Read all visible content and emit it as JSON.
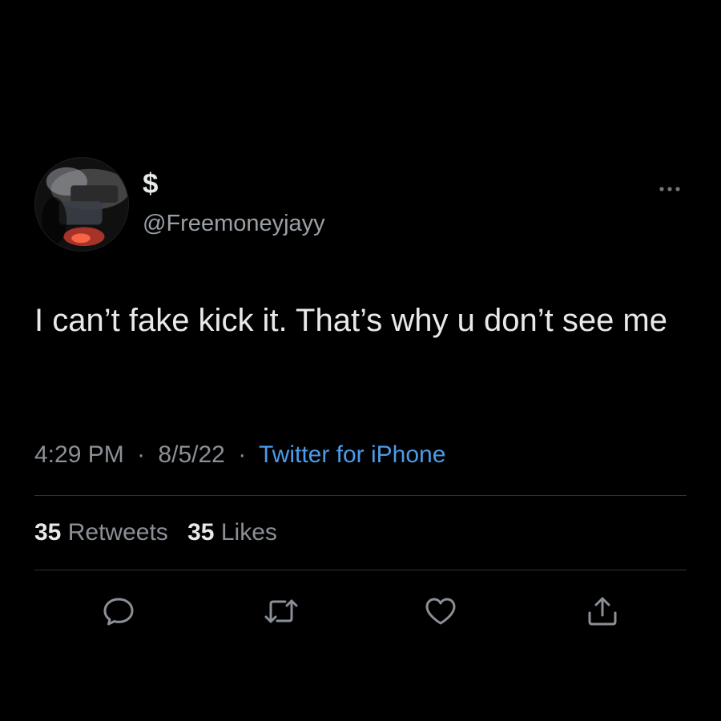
{
  "user": {
    "display_name": "$",
    "handle": "@Freemoneyjayy"
  },
  "tweet": {
    "text": "I can’t fake kick it. That’s why u don’t see me",
    "time": "4:29 PM",
    "date": "8/5/22",
    "separator": "·",
    "source": "Twitter for iPhone"
  },
  "stats": {
    "retweets_count": "35",
    "retweets_label": "Retweets",
    "likes_count": "35",
    "likes_label": "Likes"
  },
  "icons": {
    "more": "more-horizontal-icon",
    "reply": "reply-icon",
    "retweet": "retweet-icon",
    "like": "heart-icon",
    "share": "share-icon"
  },
  "colors": {
    "background": "#000000",
    "text": "#e7e9ea",
    "muted": "#8b9096",
    "link": "#4c9be8",
    "divider": "#2f3336"
  }
}
